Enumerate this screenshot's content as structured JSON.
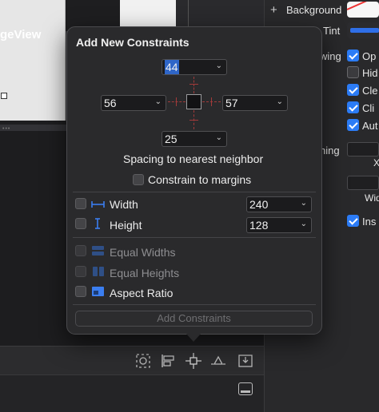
{
  "canvas": {
    "view_label": "geView"
  },
  "inspector": {
    "background_label": "Background",
    "tint_label": "Tint",
    "drawing_partial": "wing",
    "drawing_options": [
      "Op",
      "Hid",
      "Cle",
      "Cli",
      "Aut"
    ],
    "stretching_partial": "hing",
    "x_partial": "X",
    "width_partial": "Wid",
    "installed_partial": "Ins",
    "tint_color": "#2f6fe8"
  },
  "popover": {
    "title": "Add New Constraints",
    "top_value": "44",
    "left_value": "56",
    "right_value": "57",
    "bottom_value": "25",
    "spacing_label": "Spacing to nearest neighbor",
    "constrain_margins_label": "Constrain to margins",
    "width_label": "Width",
    "width_value": "240",
    "height_label": "Height",
    "height_value": "128",
    "equal_widths_label": "Equal Widths",
    "equal_heights_label": "Equal Heights",
    "aspect_ratio_label": "Aspect Ratio",
    "add_button_label": "Add Constraints",
    "accent_color": "#2c7cf6"
  },
  "toolbar": {
    "icons": [
      "update-frames-icon",
      "align-icon",
      "add-constraints-icon",
      "resolve-issues-icon",
      "embed-in-icon"
    ]
  }
}
